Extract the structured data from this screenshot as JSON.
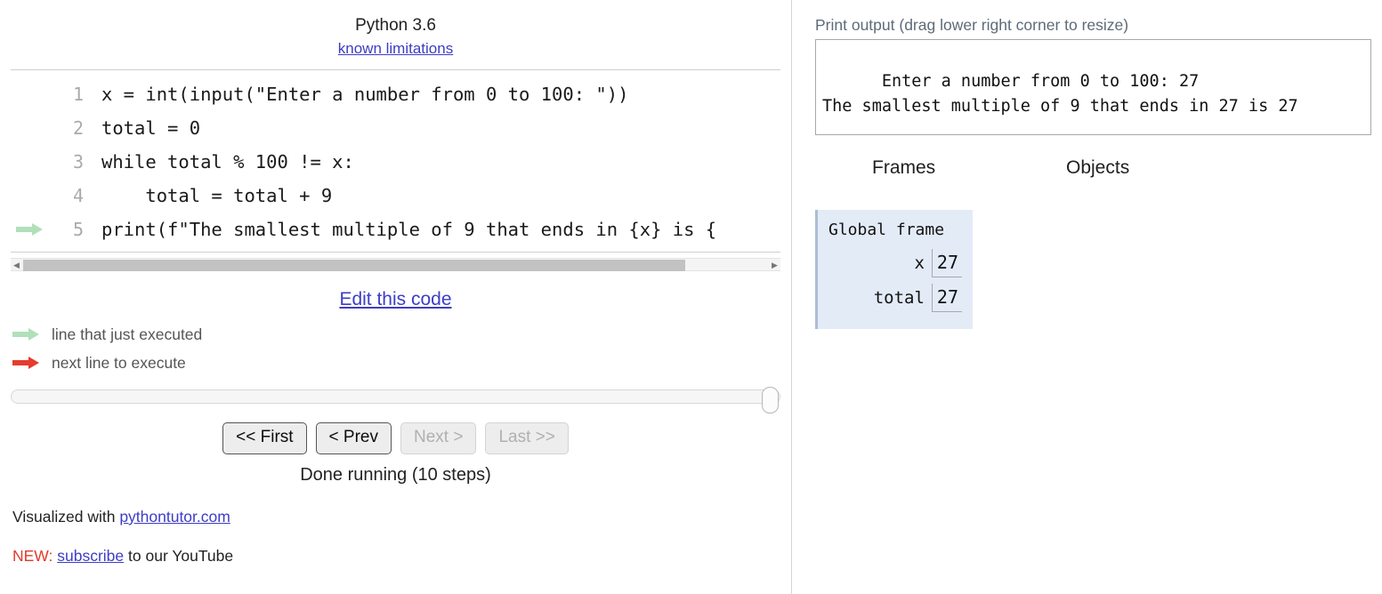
{
  "left": {
    "python_version": "Python 3.6",
    "known_limitations_link": "known limitations",
    "code_lines": [
      {
        "n": "1",
        "text": "x = int(input(\"Enter a number from 0 to 100: \"))",
        "marker": "none"
      },
      {
        "n": "2",
        "text": "total = 0",
        "marker": "none"
      },
      {
        "n": "3",
        "text": "while total % 100 != x:",
        "marker": "none"
      },
      {
        "n": "4",
        "text": "    total = total + 9",
        "marker": "none"
      },
      {
        "n": "5",
        "text": "print(f\"The smallest multiple of 9 that ends in {x} is {",
        "marker": "green"
      }
    ],
    "edit_this_code": "Edit this code",
    "legend": {
      "just_executed": "line that just executed",
      "next_line": "next line to execute",
      "green_color": "#b0e0b9",
      "red_color": "#e63b2e"
    },
    "nav": {
      "first": "<< First",
      "prev": "< Prev",
      "next": "Next >",
      "last": "Last >>",
      "first_enabled": true,
      "prev_enabled": true,
      "next_enabled": false,
      "last_enabled": false
    },
    "status": "Done running (10 steps)",
    "footer": {
      "visualized_with": "Visualized with",
      "pythontutor_link": "pythontutor.com",
      "new_label": "NEW:",
      "subscribe_link": "subscribe",
      "youtube_text": "to our YouTube"
    },
    "scrollbar": {
      "left_arrow": "◀",
      "right_arrow": "▶"
    }
  },
  "right": {
    "print_output_label": "Print output (drag lower right corner to resize)",
    "print_output_text": "Enter a number from 0 to 100: 27\nThe smallest multiple of 9 that ends in 27 is 27",
    "frames_header": "Frames",
    "objects_header": "Objects",
    "global_frame": {
      "title": "Global frame",
      "vars": [
        {
          "name": "x",
          "value": "27"
        },
        {
          "name": "total",
          "value": "27"
        }
      ]
    }
  },
  "colors": {
    "link": "#3d3dc6",
    "frame_bg": "#e3ebf7",
    "frame_border": "#adbdd4",
    "label_gray": "#5d6b79",
    "accent_red": "#e03a2b"
  }
}
